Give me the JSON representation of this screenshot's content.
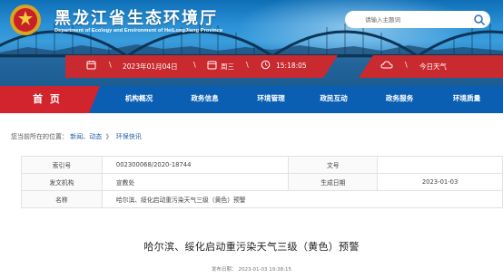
{
  "site": {
    "title": "黑龙江省生态环境厅",
    "subtitle": "Department of Ecology and Environment of HeiLongJiang Province",
    "emblem_icon": "national-emblem-icon"
  },
  "search": {
    "placeholder": "请输入主题词",
    "icon": "search-icon"
  },
  "datebar": {
    "date": "2023年01月04日",
    "weekday": "周三",
    "time": "15:18:05",
    "weather_label": "今日天气",
    "separator": "\\"
  },
  "nav": {
    "home": "首 页",
    "items": [
      "机构概况",
      "政务信息",
      "环境管理",
      "政民互动",
      "政务服务",
      "环境质量"
    ]
  },
  "breadcrumb": {
    "prefix": "您当前所在的位置：",
    "items": [
      "新闻、动态",
      "环保快讯"
    ],
    "separator": "》"
  },
  "info": {
    "index_label": "索引号",
    "index_value": "002300068/2020-18744",
    "docno_label": "文号",
    "docno_value": "",
    "issuer_label": "发文机构",
    "issuer_value": "宣教处",
    "date_label": "生成日期",
    "date_value": "2023-01-03",
    "name_label": "名称",
    "name_value": "哈尔滨、绥化启动重污染天气三级（黄色）预警"
  },
  "article": {
    "title": "哈尔滨、绥化启动重污染天气三级（黄色）预警",
    "meta_label": "发布日期：",
    "meta_value": "2023-01-03 19:38:15"
  },
  "colors": {
    "nav_blue": "#0a5fb3",
    "home_red": "#d2242c",
    "link_blue": "#1f5fa6"
  }
}
